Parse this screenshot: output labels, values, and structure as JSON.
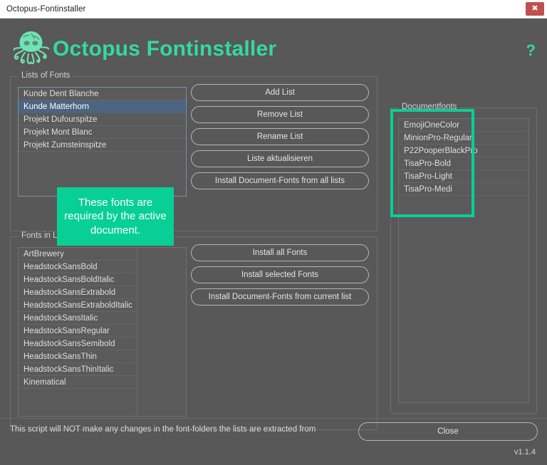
{
  "window": {
    "title": "Octopus-Fontinstaller",
    "close_glyph": "✖"
  },
  "header": {
    "app_title": "Octopus Fontinstaller",
    "help_glyph": "?",
    "logo_icon": "octopus-icon",
    "accent_color": "#34d9a0"
  },
  "lists_panel": {
    "label": "Lists of Fonts",
    "items": [
      {
        "name": "Kunde Dent Blanche",
        "selected": false
      },
      {
        "name": "Kunde Matterhorn",
        "selected": true
      },
      {
        "name": "Projekt Dufourspitze",
        "selected": false
      },
      {
        "name": "Projekt Mont Blanc",
        "selected": false
      },
      {
        "name": "Projekt Zumsteinspitze",
        "selected": false
      }
    ],
    "buttons": [
      "Add List",
      "Remove List",
      "Rename List",
      "Liste aktualisieren",
      "Install Document-Fonts from all lists"
    ]
  },
  "fonts_panel": {
    "label": "Fonts in List",
    "items": [
      {
        "name": "ArtBrewery",
        "selected": false
      },
      {
        "name": "HeadstockSansBold",
        "selected": false
      },
      {
        "name": "HeadstockSansBoldItalic",
        "selected": false
      },
      {
        "name": "HeadstockSansExtrabold",
        "selected": false
      },
      {
        "name": "HeadstockSansExtraboldItalic",
        "selected": false
      },
      {
        "name": "HeadstockSansItalic",
        "selected": false
      },
      {
        "name": "HeadstockSansRegular",
        "selected": false
      },
      {
        "name": "HeadstockSansSemibold",
        "selected": false
      },
      {
        "name": "HeadstockSansThin",
        "selected": false
      },
      {
        "name": "HeadstockSansThinItalic",
        "selected": false
      },
      {
        "name": "Kinematical",
        "selected": false
      }
    ],
    "buttons": [
      "Install all Fonts",
      "Install selected Fonts",
      "Install Document-Fonts from current list"
    ]
  },
  "documentfonts_panel": {
    "label": "Documentfonts",
    "items": [
      {
        "name": "EmojiOneColor"
      },
      {
        "name": "MinionPro-Regular"
      },
      {
        "name": "P22PooperBlackPro"
      },
      {
        "name": "TisaPro-Bold"
      },
      {
        "name": "TisaPro-Light"
      },
      {
        "name": "TisaPro-Medi"
      }
    ]
  },
  "annotations": {
    "callout_text": "These fonts are required by the active document.",
    "callout_color": "#08cf96",
    "highlight_color": "#08cf96"
  },
  "footer": {
    "note": "This script will NOT make any changes in the font-folders the lists are extracted from",
    "close_label": "Close",
    "version": "v1.1.4"
  }
}
